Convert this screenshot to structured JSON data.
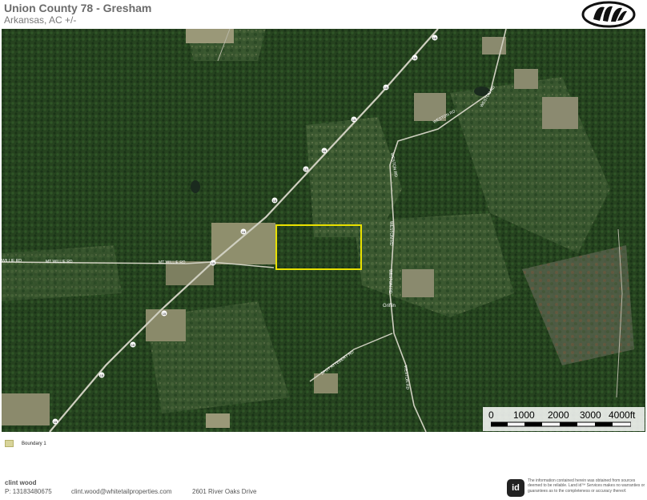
{
  "header": {
    "title": "Union County 78 - Gresham",
    "subtitle": "Arkansas,  AC +/-"
  },
  "map": {
    "roads": {
      "mt_willie_1": "WILLIE RD",
      "mt_willie_2": "MT WILLIE RD",
      "mt_willie_3": "MT WILLIE RD",
      "weston_1": "WESTON RD",
      "weston_2": "WESTON RD",
      "weston_3": "WESTON RD",
      "weston_4": "WESTON RD",
      "weston_5": "WESTON RD",
      "weston_6": "WESTON RD",
      "spot_attebery": "SPOT ATTEBERY RD"
    },
    "route_shield": "15",
    "place_label": "Griffin",
    "colors": {
      "forest_dark": "#1f3a1c",
      "forest_mid": "#2f4d27",
      "clearing": "#8a8b6a",
      "boundary": "#e8e000"
    }
  },
  "scale_bar": {
    "labels": [
      "0",
      "1000",
      "2000",
      "3000",
      "4000ft"
    ]
  },
  "legend": {
    "label": "Boundary 1"
  },
  "footer": {
    "name": "clint wood",
    "phone": "P: 13183480675",
    "email": "clint.wood@whitetailproperties.com",
    "address": "2601 River Oaks Drive",
    "badge": "id",
    "disclaimer": "The information contained herein was obtained from sources deemed to be reliable. Land id™ Services makes no warranties or guarantees as to the completeness or accuracy thereof."
  }
}
